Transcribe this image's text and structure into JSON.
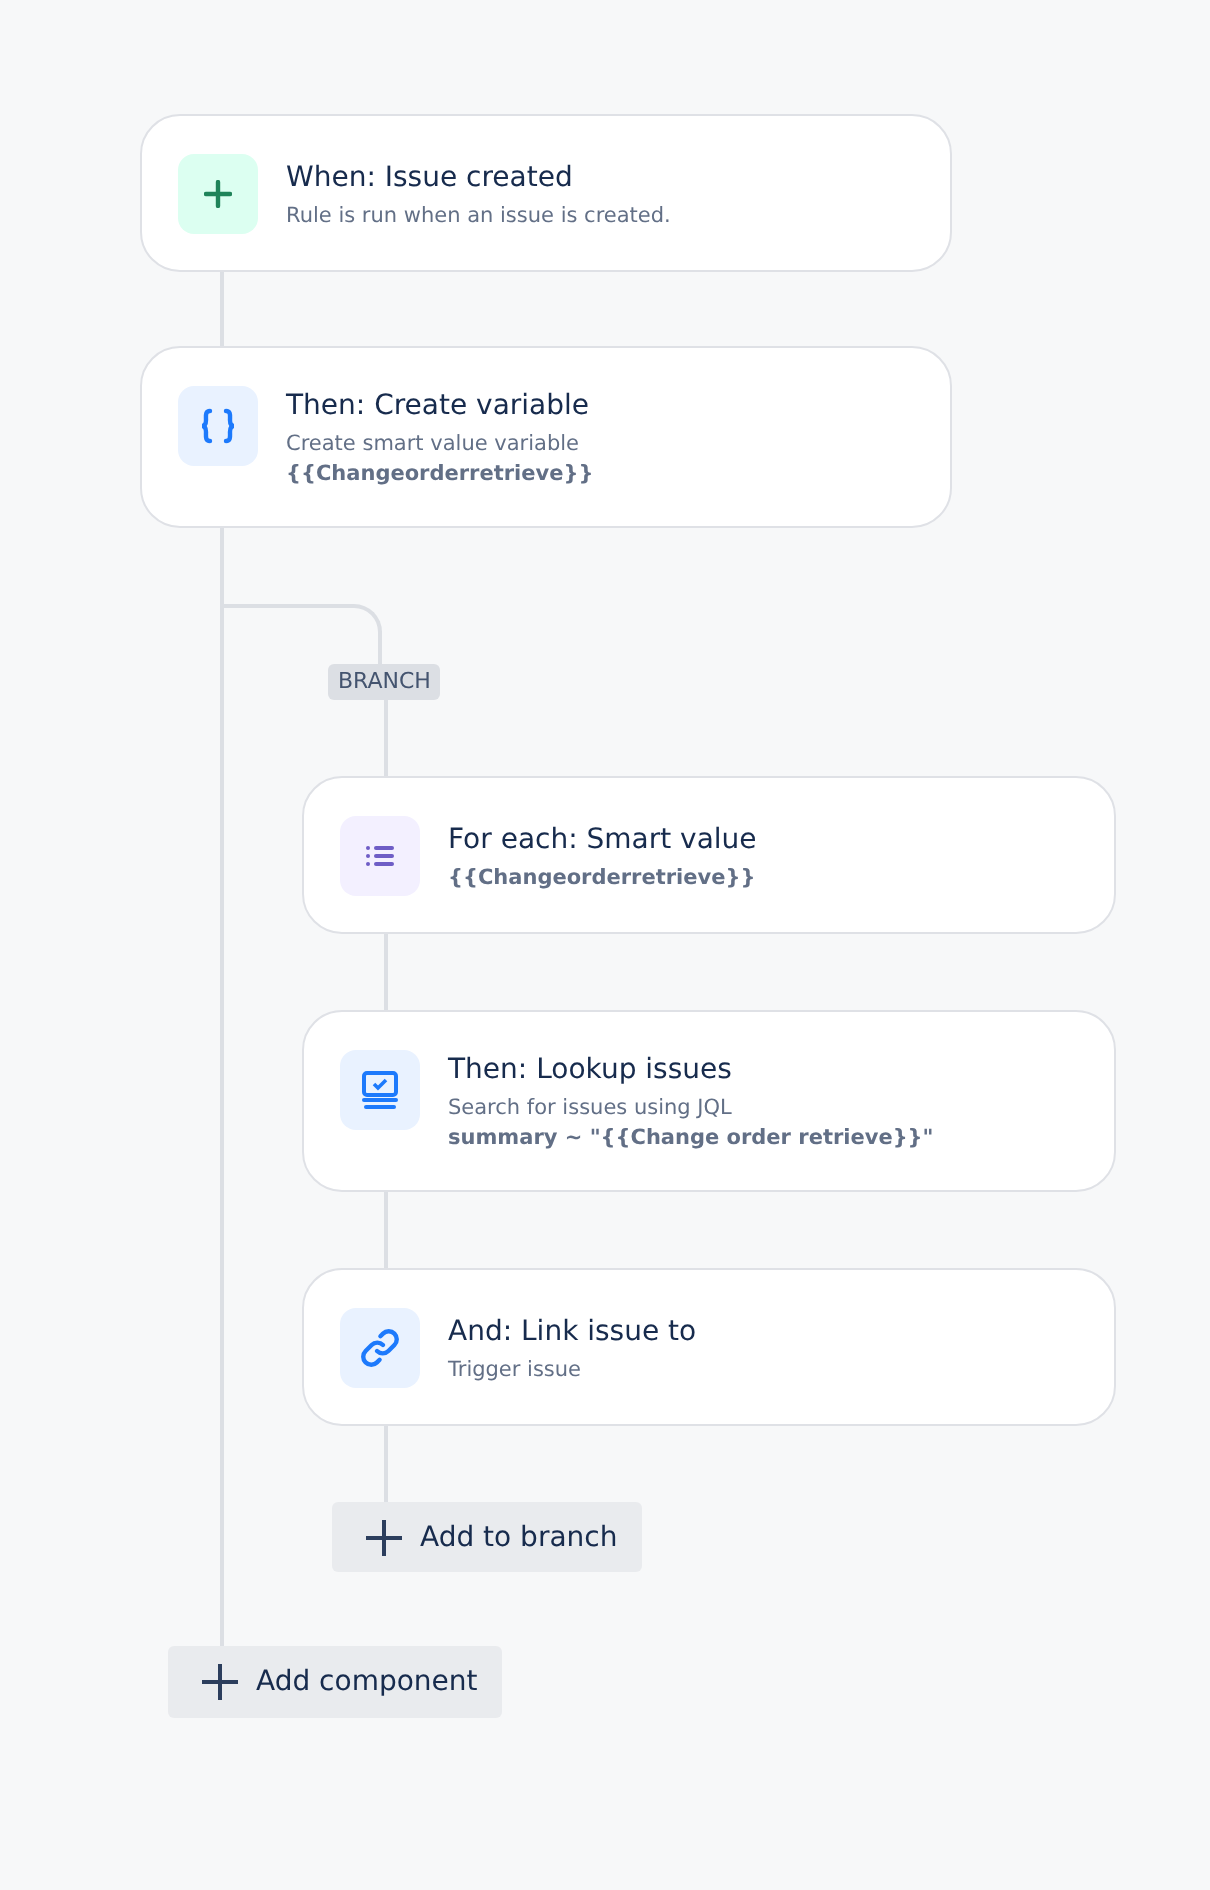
{
  "trigger": {
    "kind": "trigger",
    "title": "When: Issue created",
    "description": "Rule is run when an issue is created."
  },
  "steps": [
    {
      "kind": "variable",
      "title": "Then: Create variable",
      "description": "Create smart value variable",
      "detail": "{{Changeorderretrieve}}"
    }
  ],
  "branch": {
    "label": "BRANCH",
    "steps": [
      {
        "kind": "loop",
        "title": "For each: Smart value",
        "detail": "{{Changeorderretrieve}}"
      },
      {
        "kind": "lookup",
        "title": "Then: Lookup issues",
        "description": "Search for issues using JQL",
        "detail": "summary ~ \"{{Change order retrieve}}\""
      },
      {
        "kind": "link",
        "title": "And: Link issue to",
        "description": "Trigger issue"
      }
    ],
    "add_button": "Add to branch"
  },
  "add_button": "Add component"
}
